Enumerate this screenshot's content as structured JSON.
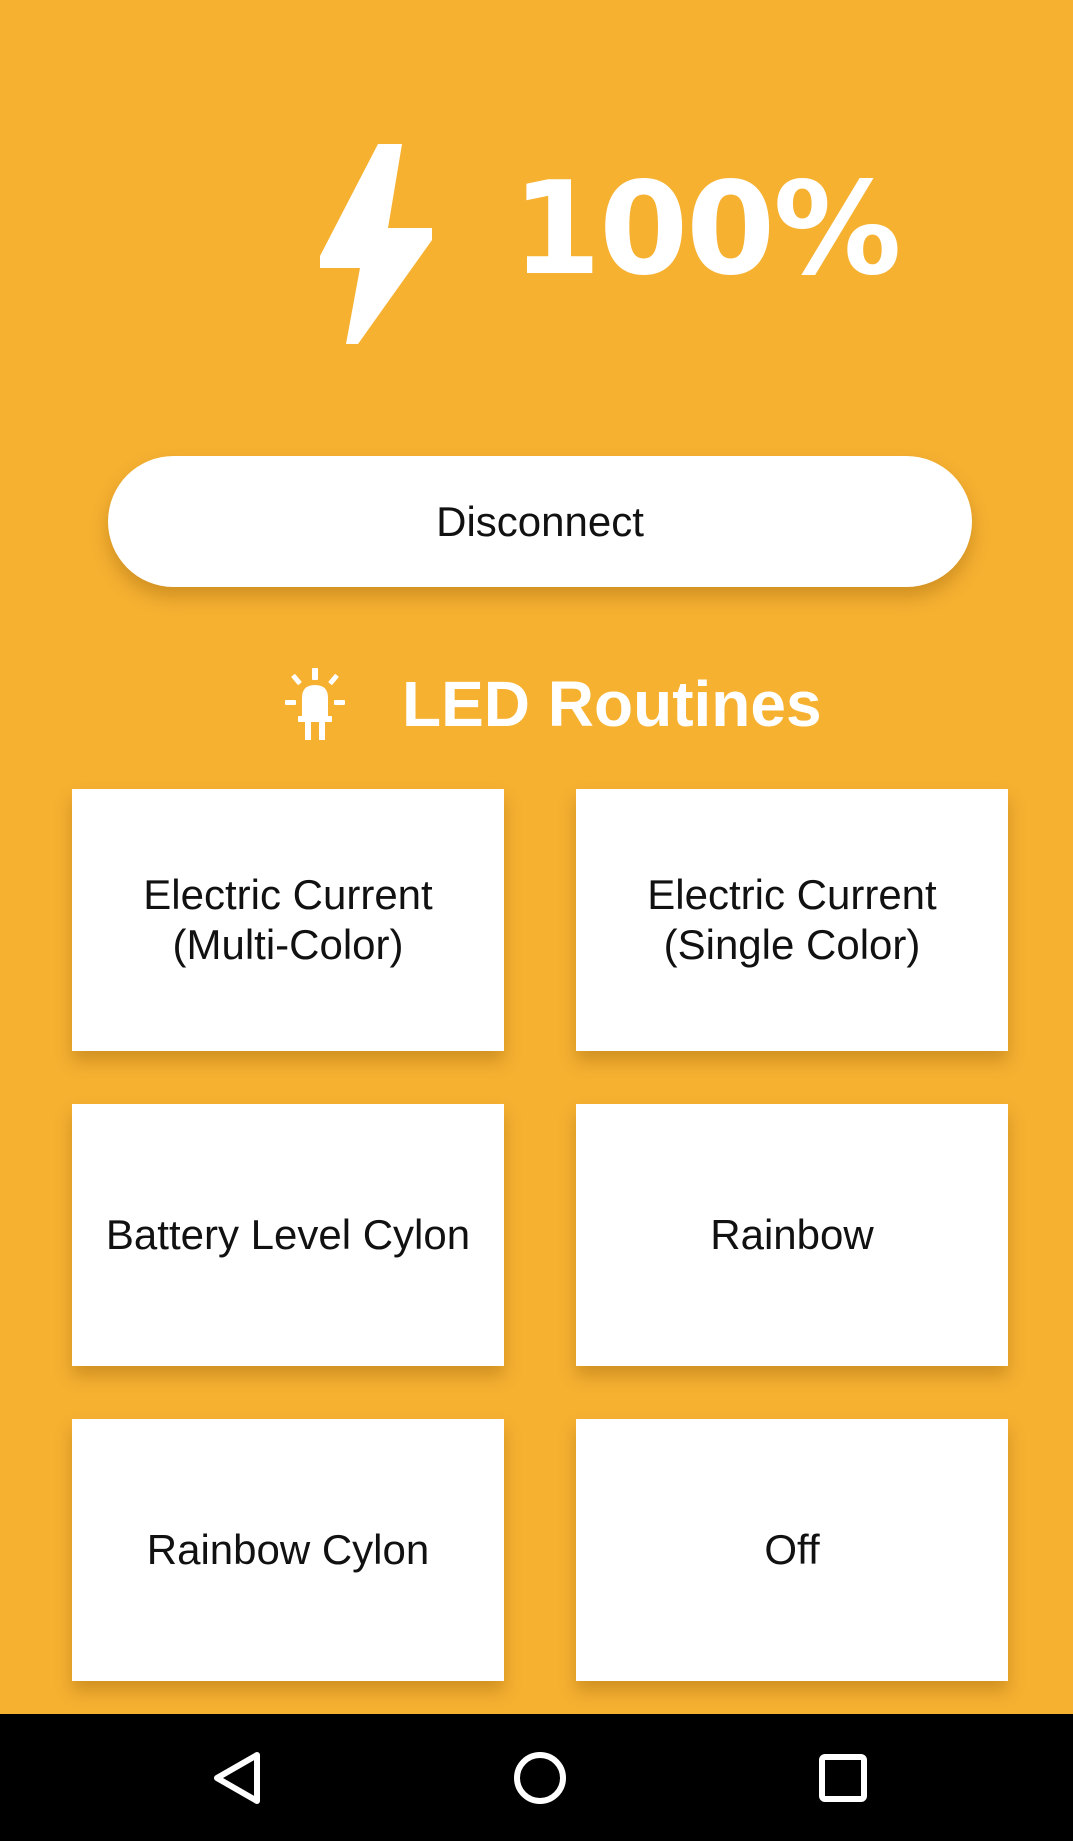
{
  "battery": {
    "level_text": "100%",
    "icon": "lightning-bolt-icon"
  },
  "connection": {
    "disconnect_label": "Disconnect"
  },
  "routines": {
    "title": "LED Routines",
    "icon": "led-bulb-icon",
    "items": [
      {
        "line1": "Electric Current",
        "line2": "(Multi-Color)"
      },
      {
        "line1": "Electric Current",
        "line2": "(Single Color)"
      },
      {
        "line1": "Battery Level Cylon",
        "line2": ""
      },
      {
        "line1": "Rainbow",
        "line2": ""
      },
      {
        "line1": "Rainbow Cylon",
        "line2": ""
      },
      {
        "line1": "Off",
        "line2": ""
      }
    ]
  },
  "nav_bar": {
    "back_icon": "back-triangle-icon",
    "home_icon": "home-circle-icon",
    "recent_icon": "recent-apps-square-icon"
  },
  "colors": {
    "background": "#F6B131",
    "card": "#FFFFFF",
    "text": "#111111",
    "nav_bar": "#000000"
  }
}
